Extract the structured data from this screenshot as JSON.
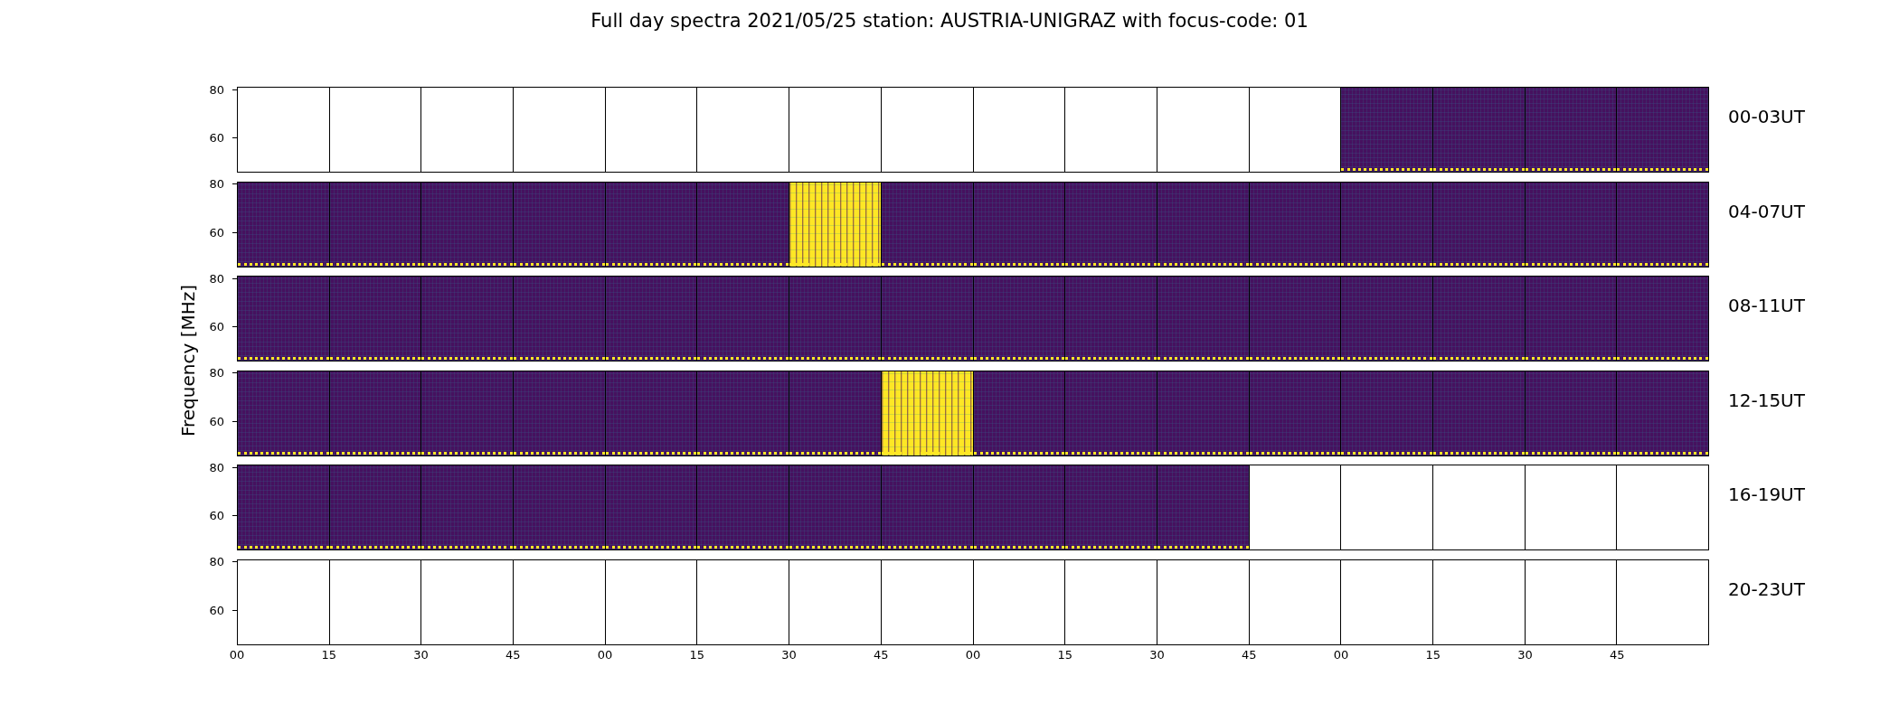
{
  "title": "Full day spectra 2021/05/25 station: AUSTRIA-UNIGRAZ with focus-code: 01",
  "ylabel": "Frequency [MHz]",
  "rows": [
    {
      "label": "00-03UT",
      "yticks": [
        "80",
        "60"
      ],
      "panels": [
        {
          "kind": "empty"
        },
        {
          "kind": "empty"
        },
        {
          "kind": "empty"
        },
        {
          "kind": "empty"
        },
        {
          "kind": "empty"
        },
        {
          "kind": "empty"
        },
        {
          "kind": "empty"
        },
        {
          "kind": "empty"
        },
        {
          "kind": "empty"
        },
        {
          "kind": "empty"
        },
        {
          "kind": "empty"
        },
        {
          "kind": "empty"
        },
        {
          "kind": "spectrum"
        },
        {
          "kind": "spectrum"
        },
        {
          "kind": "spectrum"
        },
        {
          "kind": "spectrum"
        }
      ]
    },
    {
      "label": "04-07UT",
      "yticks": [
        "80",
        "60"
      ],
      "panels": [
        {
          "kind": "spectrum"
        },
        {
          "kind": "spectrum"
        },
        {
          "kind": "spectrum"
        },
        {
          "kind": "spectrum"
        },
        {
          "kind": "spectrum"
        },
        {
          "kind": "spectrum"
        },
        {
          "kind": "saturated"
        },
        {
          "kind": "spectrum"
        },
        {
          "kind": "spectrum"
        },
        {
          "kind": "spectrum"
        },
        {
          "kind": "spectrum"
        },
        {
          "kind": "spectrum"
        },
        {
          "kind": "spectrum"
        },
        {
          "kind": "spectrum"
        },
        {
          "kind": "spectrum"
        },
        {
          "kind": "spectrum"
        }
      ]
    },
    {
      "label": "08-11UT",
      "yticks": [
        "80",
        "60"
      ],
      "panels": [
        {
          "kind": "spectrum"
        },
        {
          "kind": "spectrum"
        },
        {
          "kind": "spectrum"
        },
        {
          "kind": "spectrum"
        },
        {
          "kind": "spectrum"
        },
        {
          "kind": "spectrum"
        },
        {
          "kind": "spectrum"
        },
        {
          "kind": "spectrum"
        },
        {
          "kind": "spectrum"
        },
        {
          "kind": "spectrum"
        },
        {
          "kind": "spectrum"
        },
        {
          "kind": "spectrum"
        },
        {
          "kind": "spectrum"
        },
        {
          "kind": "spectrum"
        },
        {
          "kind": "spectrum"
        },
        {
          "kind": "spectrum"
        }
      ]
    },
    {
      "label": "12-15UT",
      "yticks": [
        "80",
        "60"
      ],
      "panels": [
        {
          "kind": "spectrum"
        },
        {
          "kind": "spectrum"
        },
        {
          "kind": "spectrum"
        },
        {
          "kind": "spectrum"
        },
        {
          "kind": "spectrum"
        },
        {
          "kind": "spectrum"
        },
        {
          "kind": "spectrum"
        },
        {
          "kind": "saturated"
        },
        {
          "kind": "spectrum"
        },
        {
          "kind": "spectrum"
        },
        {
          "kind": "spectrum"
        },
        {
          "kind": "spectrum"
        },
        {
          "kind": "spectrum"
        },
        {
          "kind": "spectrum"
        },
        {
          "kind": "spectrum"
        },
        {
          "kind": "spectrum"
        }
      ]
    },
    {
      "label": "16-19UT",
      "yticks": [
        "80",
        "60"
      ],
      "panels": [
        {
          "kind": "spectrum"
        },
        {
          "kind": "spectrum"
        },
        {
          "kind": "spectrum"
        },
        {
          "kind": "spectrum"
        },
        {
          "kind": "spectrum"
        },
        {
          "kind": "spectrum"
        },
        {
          "kind": "spectrum"
        },
        {
          "kind": "spectrum"
        },
        {
          "kind": "spectrum"
        },
        {
          "kind": "spectrum"
        },
        {
          "kind": "spectrum"
        },
        {
          "kind": "empty"
        },
        {
          "kind": "empty"
        },
        {
          "kind": "empty"
        },
        {
          "kind": "empty"
        },
        {
          "kind": "empty"
        }
      ]
    },
    {
      "label": "20-23UT",
      "yticks": [
        "80",
        "60"
      ],
      "panels": [
        {
          "kind": "empty"
        },
        {
          "kind": "empty"
        },
        {
          "kind": "empty"
        },
        {
          "kind": "empty"
        },
        {
          "kind": "empty"
        },
        {
          "kind": "empty"
        },
        {
          "kind": "empty"
        },
        {
          "kind": "empty"
        },
        {
          "kind": "empty"
        },
        {
          "kind": "empty"
        },
        {
          "kind": "empty"
        },
        {
          "kind": "empty"
        },
        {
          "kind": "empty"
        },
        {
          "kind": "empty"
        },
        {
          "kind": "empty"
        },
        {
          "kind": "empty"
        }
      ]
    }
  ],
  "xticks": [
    "00",
    "15",
    "30",
    "45",
    "00",
    "15",
    "30",
    "45",
    "00",
    "15",
    "30",
    "45",
    "00",
    "15",
    "30",
    "45"
  ]
}
